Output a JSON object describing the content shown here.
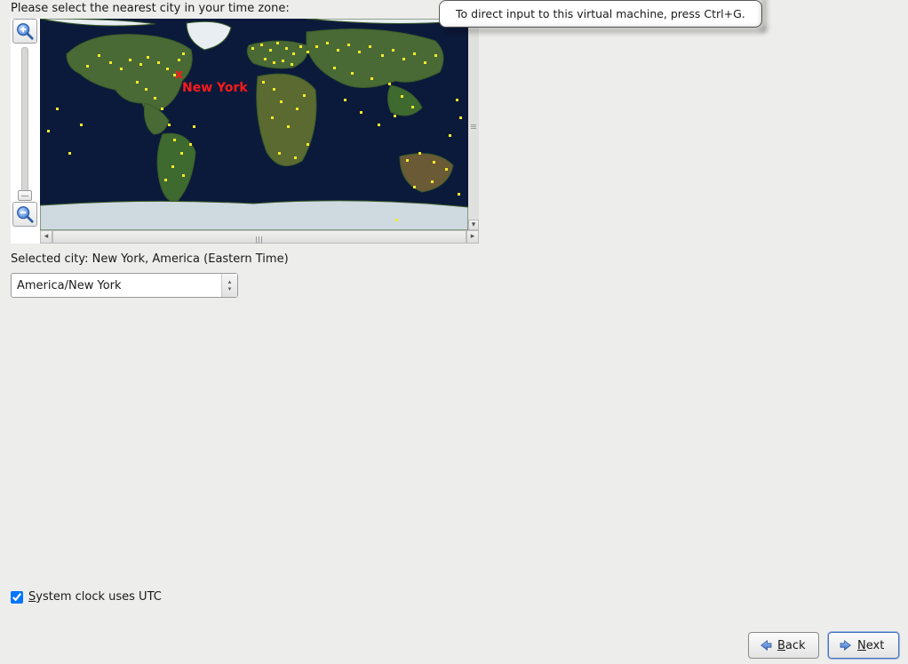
{
  "prompt": "Please select the nearest city in your time zone:",
  "tooltip": "To direct input to this virtual machine, press Ctrl+G.",
  "selected_city_label": "Selected city: New York, America (Eastern Time)",
  "timezone_value": "America/New York",
  "utc_label_pre_underline": "S",
  "utc_label_rest": "ystem clock uses UTC",
  "utc_checked": true,
  "buttons": {
    "back_u": "B",
    "back_rest": "ack",
    "next_u": "N",
    "next_rest": "ext"
  },
  "map_marker": {
    "label": "New York"
  }
}
